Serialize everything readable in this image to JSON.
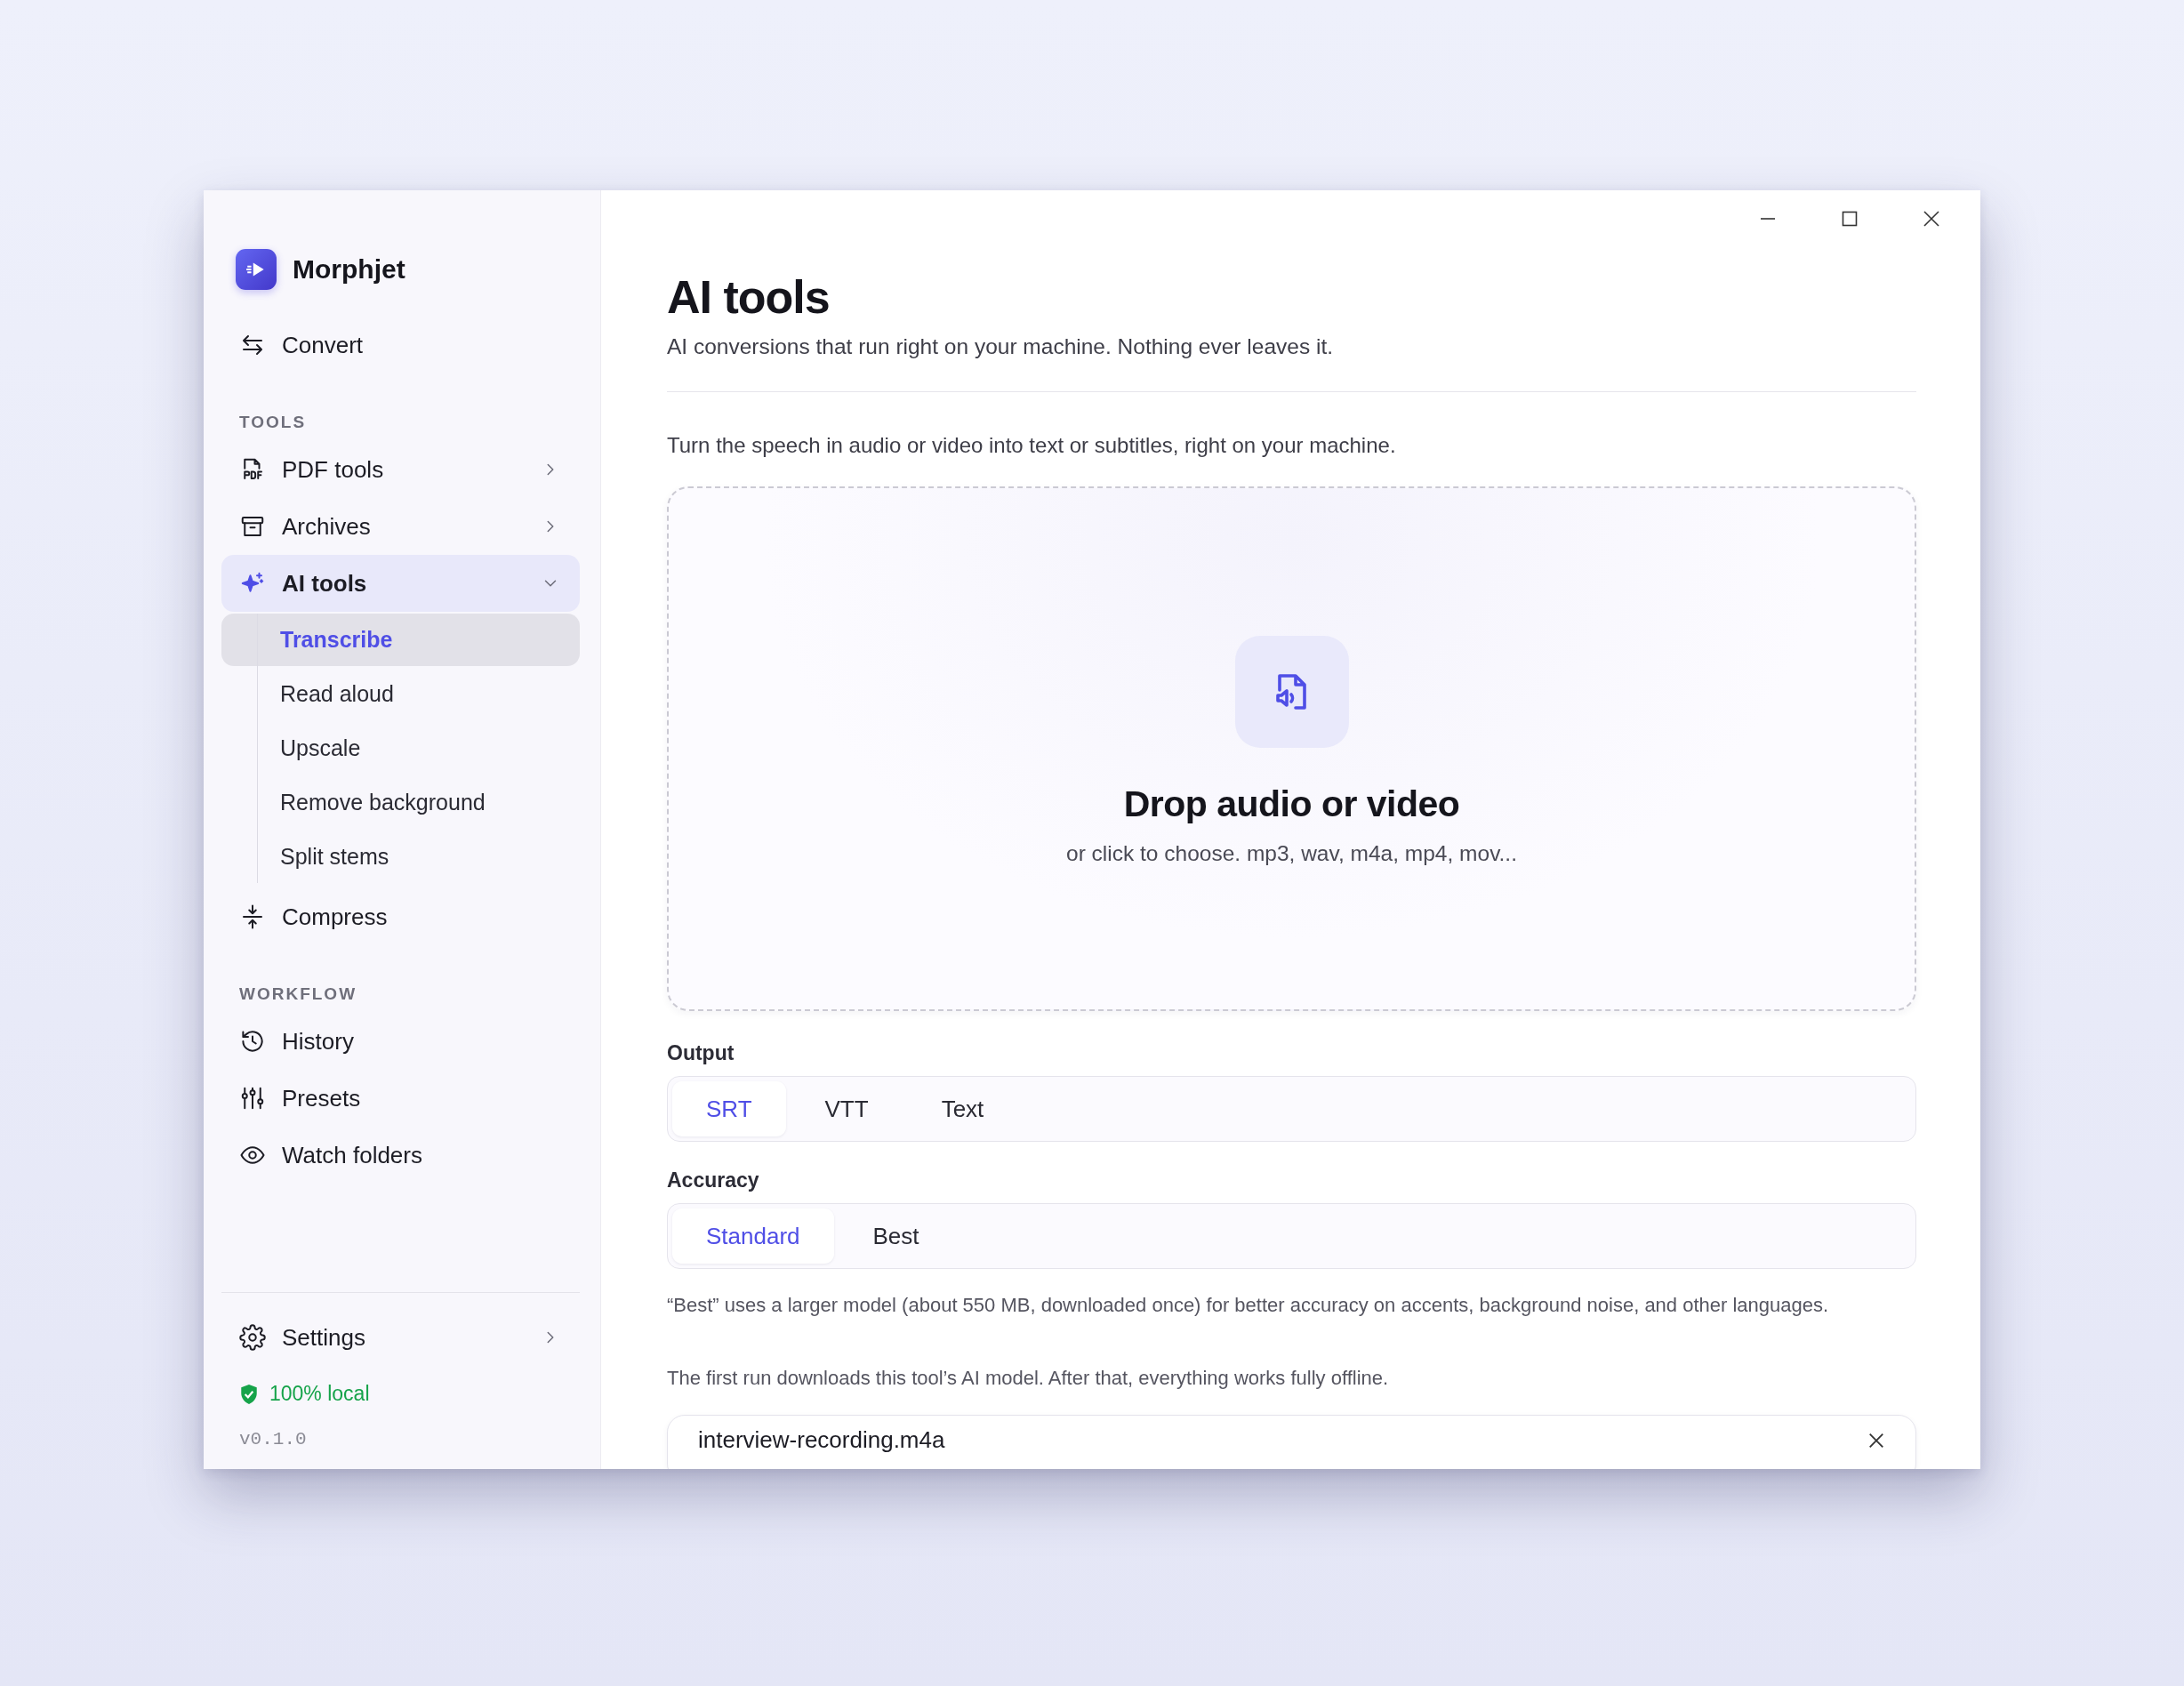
{
  "app": {
    "name": "Morphjet"
  },
  "sidebar": {
    "top_items": [
      {
        "label": "Convert",
        "selected": false
      }
    ],
    "sections": [
      {
        "heading": "TOOLS",
        "items": [
          {
            "label": "PDF tools",
            "selected": false,
            "expanded": false
          },
          {
            "label": "Archives",
            "selected": false,
            "expanded": false
          },
          {
            "label": "AI tools",
            "selected": true,
            "expanded": true,
            "children": [
              {
                "label": "Transcribe",
                "selected": true
              },
              {
                "label": "Read aloud",
                "selected": false
              },
              {
                "label": "Upscale",
                "selected": false
              },
              {
                "label": "Remove background",
                "selected": false
              },
              {
                "label": "Split stems",
                "selected": false
              }
            ]
          },
          {
            "label": "Compress",
            "selected": false
          }
        ]
      },
      {
        "heading": "WORKFLOW",
        "items": [
          {
            "label": "History",
            "selected": false
          },
          {
            "label": "Presets",
            "selected": false
          },
          {
            "label": "Watch folders",
            "selected": false
          }
        ]
      }
    ],
    "footer": {
      "settings": "Settings",
      "status": "100% local",
      "version": "v0.1.0"
    }
  },
  "main": {
    "title": "AI tools",
    "subtitle": "AI conversions that run right on your machine. Nothing ever leaves it.",
    "description": "Turn the speech in audio or video into text or subtitles, right on your machine.",
    "dropzone": {
      "title": "Drop audio or video",
      "hint": "or click to choose. mp3, wav, m4a, mp4, mov..."
    },
    "groups": [
      {
        "label": "Output",
        "options": [
          {
            "label": "SRT",
            "selected": true
          },
          {
            "label": "VTT",
            "selected": false
          },
          {
            "label": "Text",
            "selected": false
          }
        ]
      },
      {
        "label": "Accuracy",
        "options": [
          {
            "label": "Standard",
            "selected": true
          },
          {
            "label": "Best",
            "selected": false
          }
        ]
      }
    ],
    "notes": [
      "“Best” uses a larger model (about 550 MB, downloaded once) for better accuracy on accents, background noise, and other languages.",
      "The first run downloads this tool’s AI model. After that, everything works fully offline."
    ],
    "files": [
      {
        "name": "interview-recording.m4a"
      }
    ]
  }
}
